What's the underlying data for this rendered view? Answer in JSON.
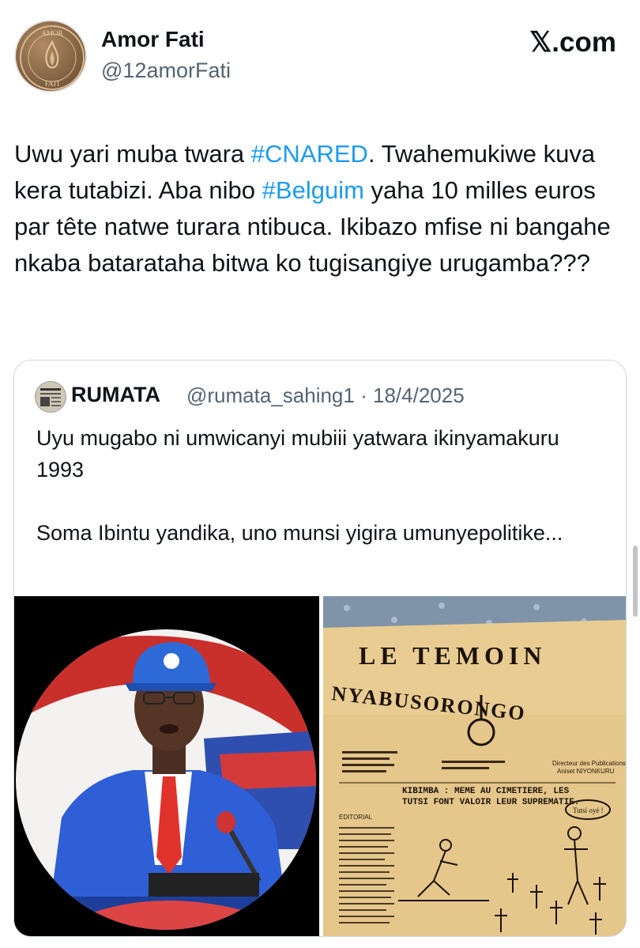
{
  "author": {
    "name": "Amor Fati",
    "handle": "@12amorFati",
    "avatar_text_top": "AMOR",
    "avatar_text_bottom": "FATI"
  },
  "brand": "𝕏.com",
  "tweet": {
    "segments": [
      {
        "text": "Uwu yari muba twara ",
        "type": "text"
      },
      {
        "text": "#CNARED",
        "type": "hashtag"
      },
      {
        "text": ". Twahemukiwe kuva kera tutabizi. Aba nibo ",
        "type": "text"
      },
      {
        "text": "#Belguim",
        "type": "hashtag"
      },
      {
        "text": " yaha 10 milles euros par tête natwe turara ntibuca. Ikibazo mfise ni bangahe nkaba batarataha bitwa ko tugisangiye urugamba???",
        "type": "text"
      }
    ]
  },
  "quoted": {
    "name": "RUMATA",
    "handle": "@rumata_sahing1",
    "separator": "·",
    "date": "18/4/2025",
    "paragraph1": "Uyu mugabo ni umwicanyi mubiii yatwara ikinyamakuru 1993",
    "paragraph2": "Soma Ibintu yandika, uno munsi yigira umunyepolitike...",
    "newspaper": {
      "title_top": "LE TEMOIN",
      "title_arc": "NYABUSORONGO",
      "headline": "KIBIMBA : MEME AU CIMETIERE, LES TUTSI FONT VALOIR LEUR SUPREMATIE.",
      "director_label": "Directeur des Publications",
      "director_name": "Aniset NIYONKURU",
      "column_title": "EDITORIAL",
      "cartoon_bubble": "Tutsi oyé !"
    }
  },
  "colors": {
    "link": "#1d9bf0",
    "secondary": "#536471",
    "border": "#cfd9de",
    "newsprint": "#e9cc92"
  }
}
